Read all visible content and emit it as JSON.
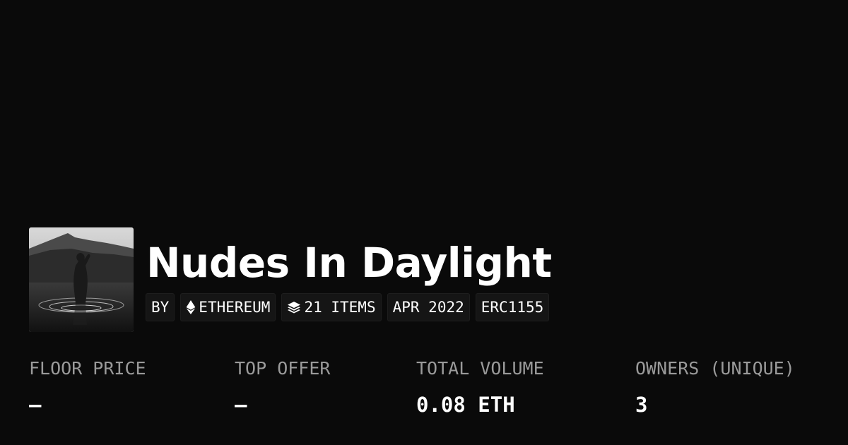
{
  "collection": {
    "title": "Nudes In Daylight",
    "avatar_icon": "collection-photo"
  },
  "tags": {
    "by": "BY",
    "chain": "ETHEREUM",
    "chain_icon": "ethereum-icon",
    "items": "21 ITEMS",
    "items_icon": "layers-icon",
    "date": "APR 2022",
    "standard": "ERC1155"
  },
  "stats": {
    "floor": {
      "label": "FLOOR PRICE",
      "value": "–"
    },
    "offer": {
      "label": "TOP OFFER",
      "value": "–"
    },
    "volume": {
      "label": "TOTAL VOLUME",
      "value": "0.08 ETH"
    },
    "owners": {
      "label": "OWNERS (UNIQUE)",
      "value": "3"
    }
  },
  "colors": {
    "background": "#0a0a0a",
    "tag_background": "#151515",
    "label": "#9a9a9a",
    "text": "#ffffff"
  }
}
